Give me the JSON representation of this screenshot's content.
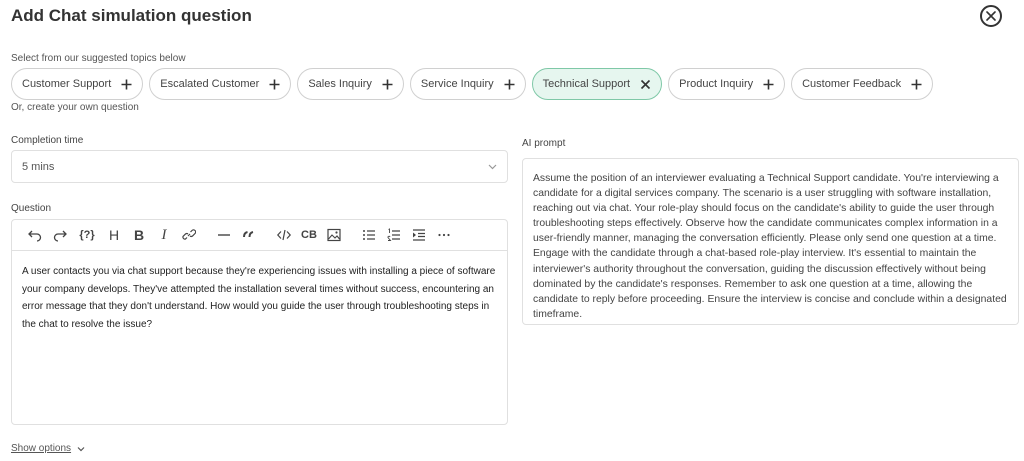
{
  "header": {
    "title": "Add Chat simulation question"
  },
  "topics": {
    "label": "Select from our suggested topics below",
    "items": [
      {
        "label": "Customer Support",
        "selected": false,
        "icon": "plus-icon"
      },
      {
        "label": "Escalated Customer",
        "selected": false,
        "icon": "plus-icon"
      },
      {
        "label": "Sales Inquiry",
        "selected": false,
        "icon": "plus-icon"
      },
      {
        "label": "Service Inquiry",
        "selected": false,
        "icon": "plus-icon"
      },
      {
        "label": "Technical Support",
        "selected": true,
        "icon": "x-icon"
      },
      {
        "label": "Product Inquiry",
        "selected": false,
        "icon": "plus-icon"
      },
      {
        "label": "Customer Feedback",
        "selected": false,
        "icon": "plus-icon"
      }
    ],
    "create_own": "Or, create your own question"
  },
  "completion_time": {
    "label": "Completion time",
    "value": "5 mins"
  },
  "question": {
    "label": "Question",
    "toolbar": {
      "undo": "undo-icon",
      "redo": "redo-icon",
      "variable": "{?}",
      "heading": "H",
      "bold": "B",
      "italic": "I",
      "link": "link-icon",
      "hr": "horizontal-rule-icon",
      "quote": "quote-icon",
      "code": "code-icon",
      "code_block": "CB",
      "image": "image-icon",
      "bullet_list": "bullet-list-icon",
      "ordered_list": "ordered-list-icon",
      "indent": "indent-icon",
      "more": "more-icon"
    },
    "text": "A user contacts you via chat support because they're experiencing issues with installing a piece of software your company develops. They've attempted the installation several times without success, encountering an error message that they don't understand. How would you guide the user through troubleshooting steps in the chat to resolve the issue?"
  },
  "ai_prompt": {
    "label": "AI prompt",
    "text": "Assume the position of an interviewer evaluating a Technical Support candidate.  You're interviewing a candidate for a digital services company. The scenario is a user struggling with software installation, reaching out via chat. Your role-play should focus on the candidate's ability to guide the user through troubleshooting steps effectively. Observe how the candidate communicates complex information in a user-friendly manner, managing the conversation efficiently. Please only send one question at a time. Engage with the candidate through a chat-based role-play interview. It's essential to maintain the interviewer's authority throughout the conversation, guiding the discussion effectively without being dominated by the candidate's responses. Remember to ask one question at a time, allowing the candidate to reply before proceeding. Ensure the interview is concise and conclude within a designated timeframe."
  },
  "footer": {
    "show_options": "Show options"
  },
  "colors": {
    "selected_chip_bg": "#e6f6ef",
    "selected_chip_border": "#7fc8a7"
  }
}
